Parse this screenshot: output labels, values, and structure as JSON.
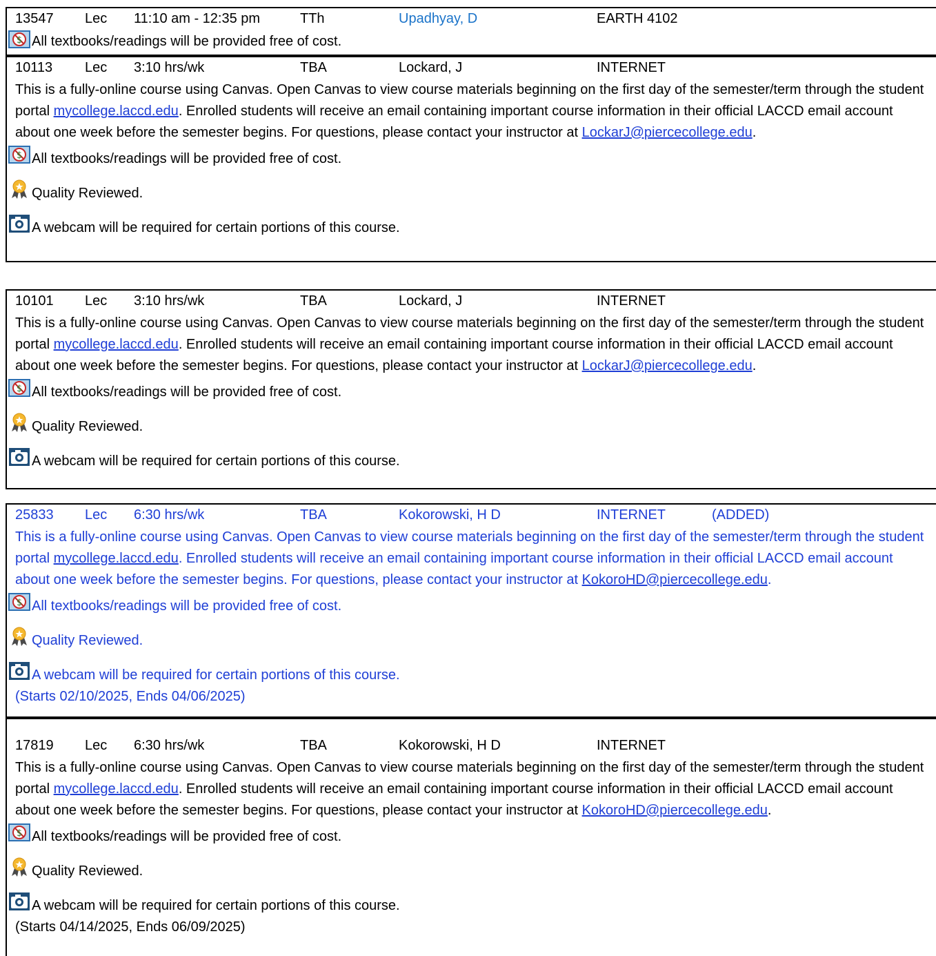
{
  "sections": [
    {
      "id": "13547",
      "type": "Lec",
      "time": "11:10 am - 12:35 pm",
      "days": "TTh",
      "instructor": "Upadhyay, D",
      "location": "EARTH 4102",
      "notes": [
        "All textbooks/readings will be provided free of cost."
      ]
    },
    {
      "id": "10113",
      "type": "Lec",
      "time": "3:10 hrs/wk",
      "days": "TBA",
      "instructor": "Lockard, J",
      "location": "INTERNET",
      "desc_before_link": "This is a fully-online course using Canvas. Open Canvas to view course materials beginning on the first day of the semester/term through the student portal ",
      "portal_link": "mycollege.laccd.edu",
      "desc_middle": ". Enrolled students will receive an email containing important course information in their official LACCD email account about one week before the semester begins. For questions, please contact your instructor at ",
      "email_link": "LockarJ@piercecollege.edu",
      "desc_end": ".",
      "notes": [
        "All textbooks/readings will be provided free of cost.",
        "Quality Reviewed.",
        "A webcam will be required for certain portions of this course."
      ]
    },
    {
      "id": "10101",
      "type": "Lec",
      "time": "3:10 hrs/wk",
      "days": "TBA",
      "instructor": "Lockard, J",
      "location": "INTERNET",
      "desc_before_link": "This is a fully-online course using Canvas. Open Canvas to view course materials beginning on the first day of the semester/term through the student portal ",
      "portal_link": "mycollege.laccd.edu",
      "desc_middle": ". Enrolled students will receive an email containing important course information in their official LACCD email account about one week before the semester begins. For questions, please contact your instructor at ",
      "email_link": "LockarJ@piercecollege.edu",
      "desc_end": ".",
      "notes": [
        "All textbooks/readings will be provided free of cost.",
        "Quality Reviewed.",
        "A webcam will be required for certain portions of this course."
      ]
    },
    {
      "id": "25833",
      "type": "Lec",
      "time": "6:30 hrs/wk",
      "days": "TBA",
      "instructor": "Kokorowski, H D",
      "location": "INTERNET",
      "status": "(ADDED)",
      "desc_before_link": "This is a fully-online course using Canvas. Open Canvas to view course materials beginning on the first day of the semester/term through the student portal ",
      "portal_link": "mycollege.laccd.edu",
      "desc_middle": ". Enrolled students will receive an email containing important course information in their official LACCD email account about one week before the semester begins. For questions, please contact your instructor at ",
      "email_link": "KokoroHD@piercecollege.edu",
      "desc_end": ".",
      "notes": [
        "All textbooks/readings will be provided free of cost.",
        "Quality Reviewed.",
        "A webcam will be required for certain portions of this course."
      ],
      "dates": "(Starts 02/10/2025, Ends 04/06/2025)"
    },
    {
      "id": "17819",
      "type": "Lec",
      "time": "6:30 hrs/wk",
      "days": "TBA",
      "instructor": "Kokorowski, H D",
      "location": "INTERNET",
      "desc_before_link": "This is a fully-online course using Canvas. Open Canvas to view course materials beginning on the first day of the semester/term through the student portal ",
      "portal_link": "mycollege.laccd.edu",
      "desc_middle": ". Enrolled students will receive an email containing important course information in their official LACCD email account about one week before the semester begins. For questions, please contact your instructor at ",
      "email_link": "KokoroHD@piercecollege.edu",
      "desc_end": ".",
      "notes": [
        "All textbooks/readings will be provided free of cost.",
        "Quality Reviewed.",
        "A webcam will be required for certain portions of this course."
      ],
      "dates": "(Starts 04/14/2025, Ends 06/09/2025)"
    }
  ],
  "colors": {
    "added_text": "#1f3fd6",
    "instructor_link": "#1a73c9",
    "border": "#000000"
  },
  "icons": [
    "zero-cost-textbook-icon",
    "quality-reviewed-award-icon",
    "webcam-camera-icon"
  ]
}
